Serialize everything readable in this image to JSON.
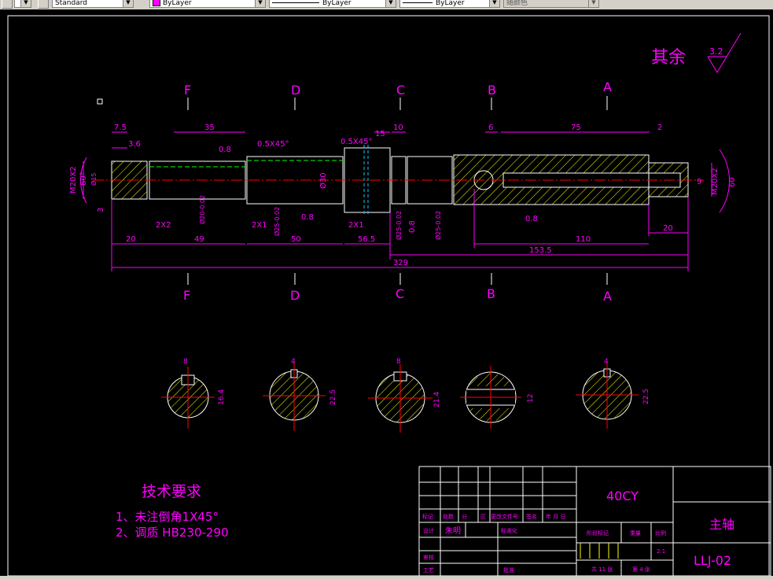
{
  "toolbar": {
    "text_style": "Standard",
    "color": "ByLayer",
    "linetype": "ByLayer",
    "lineweight": "ByLayer",
    "plot_style": "随颜色"
  },
  "drawing": {
    "roughness_label": "其余",
    "roughness_value": "3.2",
    "section_letters_top": [
      "F",
      "D",
      "C",
      "B",
      "A"
    ],
    "section_letters_bottom": [
      "F",
      "D",
      "C",
      "B",
      "A"
    ],
    "dims": {
      "d7_5": "7.5",
      "d3_6": "3.6",
      "d35": "35",
      "d0_8a": "0.8",
      "d0_5x45a": "0.5X45°",
      "d0_5x45b": "0.5X45°",
      "d15": "15",
      "d10": "10",
      "d6": "6",
      "d75": "75",
      "d2": "2",
      "m20x2_left": "M20X2",
      "deg60_left": "60°",
      "phi15": "Ø15",
      "d3": "3",
      "phi20": "Ø20-0.02",
      "phi25a": "Ø25-0.02",
      "phi30": "Ø30",
      "phi25b": "Ø25-0.02",
      "phi25c": "Ø25-0.02",
      "d2x2": "2X2",
      "d2x1a": "2X1",
      "d2x1b": "2X1",
      "d0_8b": "0.8",
      "d0_8c": "0.8",
      "d0_8d": "0.8",
      "d9": "9",
      "m20x2_right": "M20X2",
      "deg60_right": "60",
      "d20a": "20",
      "d49": "49",
      "d50": "50",
      "d56_5": "56.5",
      "d110": "110",
      "d20b": "20",
      "d153_5": "153.5",
      "d329": "329"
    },
    "sections": [
      {
        "width": "8",
        "height": "16.4"
      },
      {
        "width": "4",
        "height": "22.5"
      },
      {
        "width": "8",
        "height": "21.4"
      },
      {
        "width": "",
        "height": "12"
      },
      {
        "width": "4",
        "height": "22.5"
      }
    ],
    "tech_req": {
      "title": "技术要求",
      "line1": "1、未注倒角1X45°",
      "line2": "2、调质 HB230-290"
    },
    "title_block": {
      "material": "40CY",
      "part_name": "主轴",
      "drawing_no": "LLJ-02",
      "row_labels": [
        "标记",
        "处数",
        "分",
        "区",
        "更改文件号",
        "签名",
        "年 月 日"
      ],
      "design_label": "设计",
      "designer": "朱明",
      "standard_label": "标准化",
      "stage_label": "阶段标记",
      "weight_label": "重量",
      "scale_label": "比例",
      "scale_value": "2:1",
      "review_label": "审核",
      "process_label": "工艺",
      "approve_label": "批准",
      "sheets_total": "共 11 张",
      "sheet_no": "第 4 张"
    }
  }
}
